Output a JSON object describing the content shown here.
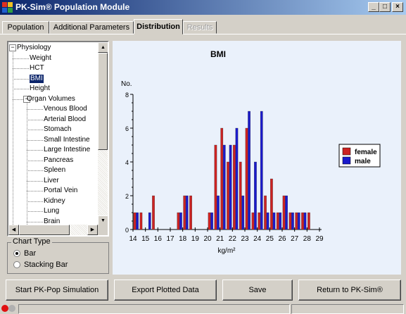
{
  "window": {
    "title": "PK-Sim® Population Module",
    "controls": [
      "_",
      "□",
      "×"
    ]
  },
  "tabs": [
    {
      "label": "Population",
      "active": false,
      "enabled": true
    },
    {
      "label": "Additional Parameters",
      "active": false,
      "enabled": true
    },
    {
      "label": "Distribution",
      "active": true,
      "enabled": true
    },
    {
      "label": "Results",
      "active": false,
      "enabled": false
    }
  ],
  "tree": {
    "items": [
      {
        "label": "Physiology",
        "level": 0,
        "expander": "−"
      },
      {
        "label": "Weight",
        "level": 1
      },
      {
        "label": "HCT",
        "level": 1
      },
      {
        "label": "BMI",
        "level": 1,
        "selected": true
      },
      {
        "label": "Height",
        "level": 1
      },
      {
        "label": "Organ Volumes",
        "level": 1,
        "expander": "−"
      },
      {
        "label": "Venous Blood",
        "level": 2
      },
      {
        "label": "Arterial Blood",
        "level": 2
      },
      {
        "label": "Stomach",
        "level": 2
      },
      {
        "label": "Small Intestine",
        "level": 2
      },
      {
        "label": "Large Intestine",
        "level": 2
      },
      {
        "label": "Pancreas",
        "level": 2
      },
      {
        "label": "Spleen",
        "level": 2
      },
      {
        "label": "Liver",
        "level": 2
      },
      {
        "label": "Portal Vein",
        "level": 2
      },
      {
        "label": "Kidney",
        "level": 2
      },
      {
        "label": "Lung",
        "level": 2
      },
      {
        "label": "Brain",
        "level": 2
      }
    ]
  },
  "chart_type": {
    "label": "Chart Type",
    "options": [
      {
        "label": "Bar",
        "selected": true
      },
      {
        "label": "Stacking Bar",
        "selected": false
      }
    ]
  },
  "chart_data": {
    "type": "bar",
    "title": "BMI",
    "ylabel": "No.",
    "xlabel": "kg/m²",
    "ylim": [
      0,
      8
    ],
    "yticks": [
      0,
      2,
      4,
      6,
      8
    ],
    "xlim": [
      14,
      29
    ],
    "xticks": [
      14,
      15,
      16,
      17,
      18,
      19,
      20,
      21,
      22,
      23,
      24,
      25,
      26,
      27,
      28,
      29
    ],
    "bin_width": 0.5,
    "legend_position": "right",
    "series": [
      {
        "name": "female",
        "color": "#cc2222",
        "x": [
          14.0,
          14.5,
          15.5,
          16.0,
          16.5,
          17.0,
          17.5,
          18.0,
          18.5,
          19.0,
          20.0,
          20.5,
          21.0,
          21.5,
          22.0,
          22.5,
          23.0,
          23.5,
          24.0,
          24.5,
          25.0,
          25.5,
          26.0,
          26.5,
          27.0,
          27.5,
          28.0
        ],
        "values": [
          1,
          1,
          2,
          0,
          0,
          0,
          1,
          2,
          2,
          0,
          1,
          5,
          6,
          4,
          5,
          4,
          6,
          1,
          1,
          2,
          3,
          1,
          2,
          1,
          1,
          1,
          1
        ]
      },
      {
        "name": "male",
        "color": "#1a1acc",
        "x": [
          14.0,
          15.0,
          15.5,
          16.0,
          16.5,
          17.0,
          17.5,
          18.0,
          18.5,
          19.0,
          20.0,
          20.5,
          21.0,
          21.5,
          22.0,
          22.5,
          23.0,
          23.5,
          24.0,
          24.5,
          25.0,
          25.5,
          26.0,
          26.5,
          27.0,
          27.5,
          28.0
        ],
        "values": [
          1,
          1,
          0,
          0,
          0,
          0,
          1,
          2,
          0,
          0,
          1,
          2,
          5,
          5,
          6,
          2,
          7,
          4,
          7,
          1,
          1,
          1,
          2,
          1,
          1,
          1,
          0
        ]
      }
    ]
  },
  "buttons": {
    "start": "Start PK-Pop Simulation",
    "export": "Export Plotted Data",
    "save": "Save",
    "return": "Return to PK-Sim®"
  }
}
